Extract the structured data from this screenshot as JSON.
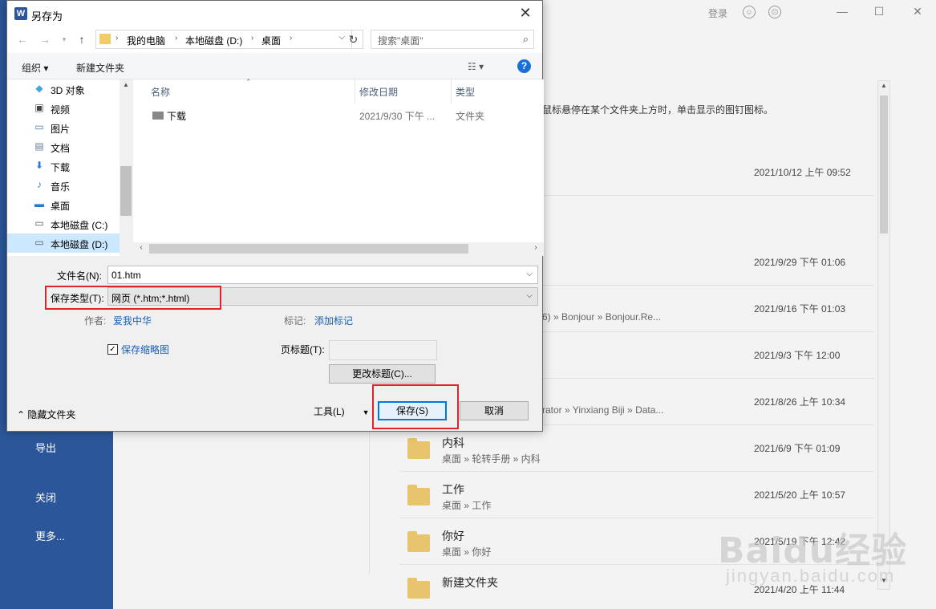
{
  "background": {
    "left_menu": [
      "导出",
      "关闭",
      "更多..."
    ],
    "login": "登录",
    "window_buttons": [
      "—",
      "☐",
      "✕"
    ],
    "tip": "鼠标悬停在某个文件夹上方时，单击显示的图钉图标。",
    "rows": [
      {
        "name": "",
        "path": "",
        "date": "2021/10/12 上午 09:52"
      },
      {
        "name": "",
        "path": "",
        "date": "2021/9/29 下午 01:06"
      },
      {
        "name": "",
        "path": "6) » Bonjour » Bonjour.Re...",
        "date": "2021/9/16 下午 01:03"
      },
      {
        "name": "",
        "path": "",
        "date": "2021/9/3 下午 12:00"
      },
      {
        "name": "",
        "path": "rator » Yinxiang Biji » Data...",
        "date": "2021/8/26 上午 10:34"
      },
      {
        "name": "内科",
        "path": "桌面 » 轮转手册 » 内科",
        "date": "2021/6/9 下午 01:09"
      },
      {
        "name": "工作",
        "path": "桌面 » 工作",
        "date": "2021/5/20 上午 10:57"
      },
      {
        "name": "你好",
        "path": "桌面 » 你好",
        "date": "2021/5/19 下午 12:42"
      },
      {
        "name": "新建文件夹",
        "path": "",
        "date": "2021/4/20 上午 11:44"
      }
    ],
    "watermark": "Baidu经验",
    "watermark_url": "jingyan.baidu.com"
  },
  "dialog": {
    "title": "另存为",
    "title_icon": "W",
    "close": "✕",
    "breadcrumb": [
      "我的电脑",
      "本地磁盘 (D:)",
      "桌面"
    ],
    "search_placeholder": "搜索\"桌面\"",
    "toolbar": {
      "organize": "组织 ▾",
      "new_folder": "新建文件夹",
      "view": "☷ ▾",
      "help": "?"
    },
    "nav_items": [
      {
        "label": "3D 对象",
        "icon": "cube-icon"
      },
      {
        "label": "视频",
        "icon": "film-icon"
      },
      {
        "label": "图片",
        "icon": "picture-icon"
      },
      {
        "label": "文档",
        "icon": "document-icon"
      },
      {
        "label": "下载",
        "icon": "download-icon"
      },
      {
        "label": "音乐",
        "icon": "music-icon"
      },
      {
        "label": "桌面",
        "icon": "desktop-icon"
      },
      {
        "label": "本地磁盘 (C:)",
        "icon": "drive-icon"
      },
      {
        "label": "本地磁盘 (D:)",
        "icon": "drive-icon"
      }
    ],
    "columns": {
      "name": "名称",
      "date": "修改日期",
      "type": "类型"
    },
    "files": [
      {
        "name": "下载",
        "date": "2021/9/30 下午 ...",
        "type": "文件夹"
      }
    ],
    "filename_label": "文件名(N):",
    "filename_value": "01.htm",
    "savetype_label": "保存类型(T):",
    "savetype_value": "网页 (*.htm;*.html)",
    "author_label": "作者:",
    "author_value": "爱我中华",
    "tags_label": "标记:",
    "tags_value": "添加标记",
    "thumbnail_label": "保存缩略图",
    "page_title_label": "页标题(T):",
    "change_title_button": "更改标题(C)...",
    "hide_folders": "隐藏文件夹",
    "tools": "工具(L)",
    "save_button": "保存(S)",
    "cancel_button": "取消",
    "highlight_color": "#e0232b"
  }
}
